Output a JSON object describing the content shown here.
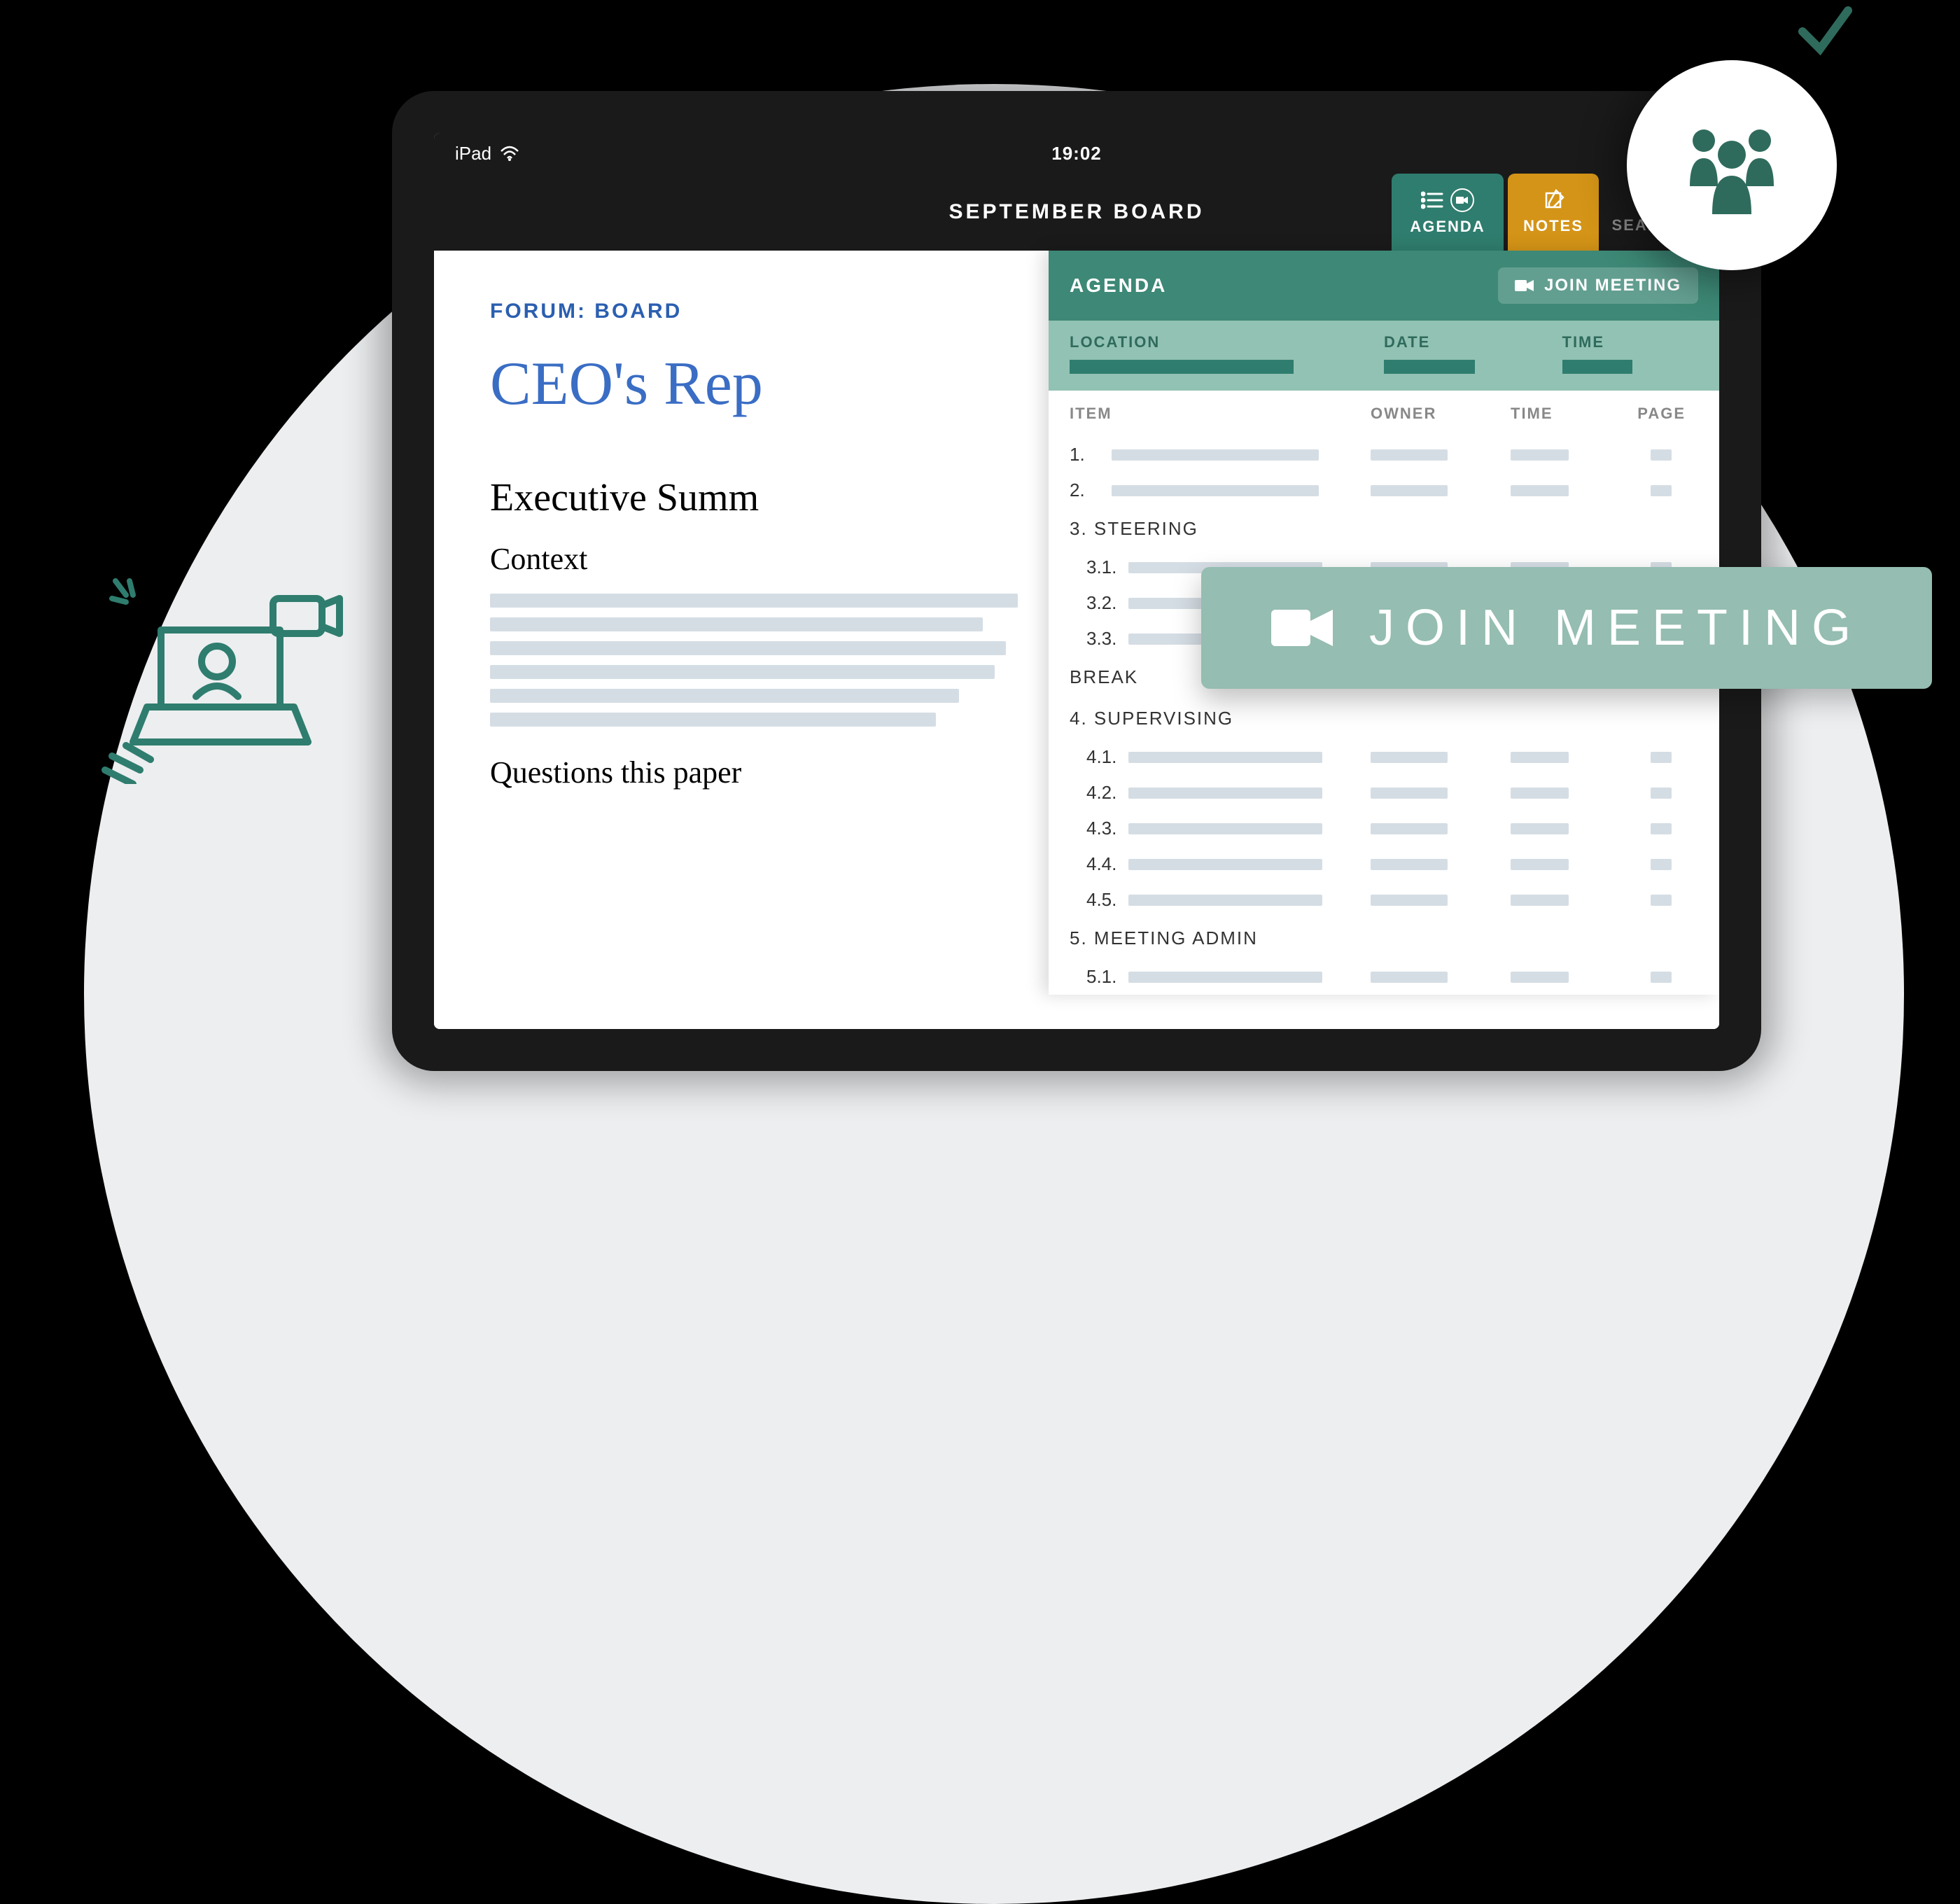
{
  "status": {
    "device": "iPad",
    "time": "19:02"
  },
  "app": {
    "title": "SEPTEMBER BOARD",
    "tabs": {
      "agenda": "AGENDA",
      "notes": "NOTES",
      "search": "SEARCH"
    }
  },
  "document": {
    "forum": "FORUM: BOARD",
    "title": "CEO's Rep",
    "h2": "Executive Summ",
    "h3": "Context",
    "h4": "Questions this paper"
  },
  "agenda": {
    "title": "AGENDA",
    "join_label": "JOIN MEETING",
    "meta": {
      "location": "LOCATION",
      "date": "DATE",
      "time": "TIME"
    },
    "cols": {
      "item": "ITEM",
      "owner": "OWNER",
      "time": "TIME",
      "page": "PAGE"
    },
    "items": [
      {
        "num": "1.",
        "type": "row"
      },
      {
        "num": "2.",
        "type": "row"
      },
      {
        "num": "3.",
        "label": "STEERING",
        "type": "heading"
      },
      {
        "num": "3.1.",
        "type": "subrow"
      },
      {
        "num": "3.2.",
        "type": "subrow"
      },
      {
        "num": "3.3.",
        "type": "subrow"
      },
      {
        "label": "BREAK",
        "type": "break"
      },
      {
        "num": "4.",
        "label": "SUPERVISING",
        "type": "heading"
      },
      {
        "num": "4.1.",
        "type": "subrow"
      },
      {
        "num": "4.2.",
        "type": "subrow"
      },
      {
        "num": "4.3.",
        "type": "subrow"
      },
      {
        "num": "4.4.",
        "type": "subrow"
      },
      {
        "num": "4.5.",
        "type": "subrow"
      },
      {
        "num": "5.",
        "label": "MEETING ADMIN",
        "type": "heading"
      },
      {
        "num": "5.1.",
        "type": "subrow"
      }
    ]
  },
  "floating": {
    "join": "JOIN MEETING"
  }
}
